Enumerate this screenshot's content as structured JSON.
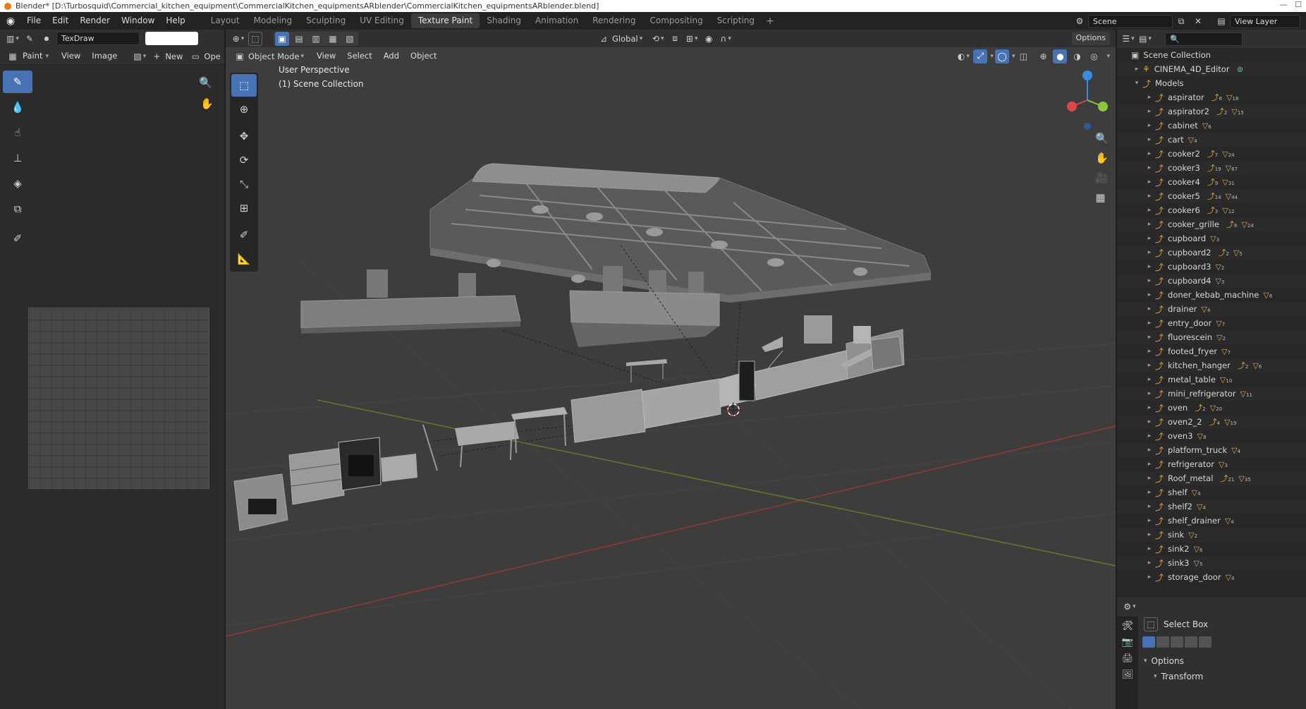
{
  "titlebar": {
    "text": "Blender* [D:\\Turbosquid\\Commercial_kitchen_equipment\\CommercialKitchen_equipmentsARblender\\CommercialKitchen_equipmentsARblender.blend]"
  },
  "menu": [
    "File",
    "Edit",
    "Render",
    "Window",
    "Help"
  ],
  "workspaces": [
    "Layout",
    "Modeling",
    "Sculpting",
    "UV Editing",
    "Texture Paint",
    "Shading",
    "Animation",
    "Rendering",
    "Compositing",
    "Scripting"
  ],
  "active_workspace": "Texture Paint",
  "scene": {
    "name": "Scene",
    "view_layer": "View Layer"
  },
  "image_editor": {
    "brush_name": "TexDraw",
    "mode": "Paint",
    "menus": [
      "View",
      "Image"
    ],
    "new_label": "New",
    "open_label": "Ope"
  },
  "viewport": {
    "mode": "Object Mode",
    "menus": [
      "View",
      "Select",
      "Add",
      "Object"
    ],
    "orientation": "Global",
    "options_label": "Options",
    "info_line1": "User Perspective",
    "info_line2": "(1) Scene Collection",
    "gizmo_axes": {
      "x_color": "#e04848",
      "y_color": "#8cc63f",
      "z_color": "#3b8be0"
    }
  },
  "outliner": {
    "root": "Scene Collection",
    "collections": [
      "CINEMA_4D_Editor",
      "Models"
    ],
    "items": [
      {
        "name": "aspirator",
        "a": "6",
        "b": "18"
      },
      {
        "name": "aspirator2",
        "a": "2",
        "b": "15"
      },
      {
        "name": "cabinet",
        "a": "",
        "b": "6"
      },
      {
        "name": "cart",
        "a": "",
        "b": "4"
      },
      {
        "name": "cooker2",
        "a": "7",
        "b": "24"
      },
      {
        "name": "cooker3",
        "a": "19",
        "b": "67"
      },
      {
        "name": "cooker4",
        "a": "9",
        "b": "31"
      },
      {
        "name": "cooker5",
        "a": "14",
        "b": "44"
      },
      {
        "name": "cooker6",
        "a": "3",
        "b": "12"
      },
      {
        "name": "cooker_grille",
        "a": "8",
        "b": "24"
      },
      {
        "name": "cupboard",
        "a": "",
        "b": "3"
      },
      {
        "name": "cupboard2",
        "a": "2",
        "b": "5"
      },
      {
        "name": "cupboard3",
        "a": "",
        "b": "2"
      },
      {
        "name": "cupboard4",
        "a": "",
        "b": "3"
      },
      {
        "name": "doner_kebab_machine",
        "a": "",
        "b": "6"
      },
      {
        "name": "drainer",
        "a": "",
        "b": "4"
      },
      {
        "name": "entry_door",
        "a": "",
        "b": "7"
      },
      {
        "name": "fluorescein",
        "a": "",
        "b": "2"
      },
      {
        "name": "footed_fryer",
        "a": "",
        "b": "7"
      },
      {
        "name": "kitchen_hanger",
        "a": "2",
        "b": "6"
      },
      {
        "name": "metal_table",
        "a": "",
        "b": "10"
      },
      {
        "name": "mini_refrigerator",
        "a": "",
        "b": "11"
      },
      {
        "name": "oven",
        "a": "2",
        "b": "20"
      },
      {
        "name": "oven2_2",
        "a": "4",
        "b": "19"
      },
      {
        "name": "oven3",
        "a": "",
        "b": "8"
      },
      {
        "name": "platform_truck",
        "a": "",
        "b": "4"
      },
      {
        "name": "refrigerator",
        "a": "",
        "b": "3"
      },
      {
        "name": "Roof_metal",
        "a": "21",
        "b": "35"
      },
      {
        "name": "shelf",
        "a": "",
        "b": "4"
      },
      {
        "name": "shelf2",
        "a": "",
        "b": "4"
      },
      {
        "name": "shelf_drainer",
        "a": "",
        "b": "4"
      },
      {
        "name": "sink",
        "a": "",
        "b": "2"
      },
      {
        "name": "sink2",
        "a": "",
        "b": "6"
      },
      {
        "name": "sink3",
        "a": "",
        "b": "5"
      },
      {
        "name": "storage_door",
        "a": "",
        "b": "4"
      }
    ]
  },
  "properties": {
    "tool": "Select Box",
    "options": "Options",
    "transform": "Transform"
  },
  "colors": {
    "accent": "#4772b3",
    "object_icon": "#e8a33a"
  }
}
